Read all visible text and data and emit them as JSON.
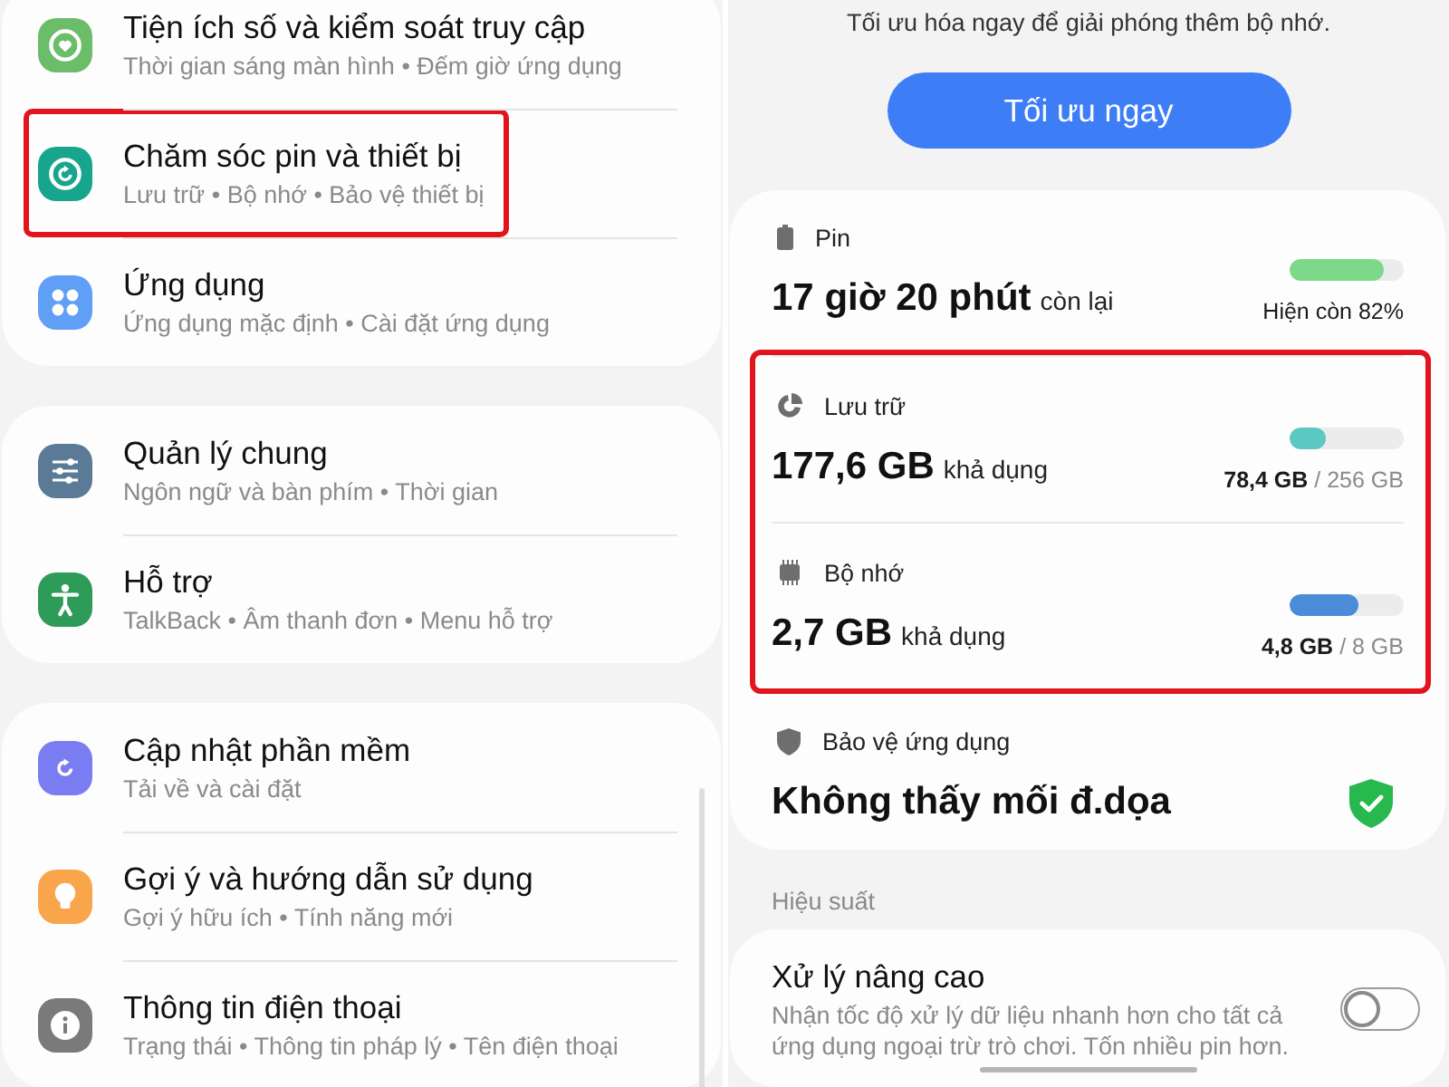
{
  "settings": {
    "groups": [
      {
        "items": [
          {
            "title": "Tiện ích số và kiểm soát truy cập",
            "subtitle": "Thời gian sáng màn hình • Đếm giờ ứng dụng",
            "color": "#6cbd6a",
            "highlighted": false
          },
          {
            "title": "Chăm sóc pin và thiết bị",
            "subtitle": "Lưu trữ • Bộ nhớ • Bảo vệ thiết bị",
            "color": "#17a68d",
            "highlighted": true
          },
          {
            "title": "Ứng dụng",
            "subtitle": "Ứng dụng mặc định • Cài đặt ứng dụng",
            "color": "#5f9ff5",
            "highlighted": false
          }
        ]
      },
      {
        "items": [
          {
            "title": "Quản lý chung",
            "subtitle": "Ngôn ngữ và bàn phím • Thời gian",
            "color": "#5a7a96",
            "highlighted": false
          },
          {
            "title": "Hỗ trợ",
            "subtitle": "TalkBack • Âm thanh đơn • Menu hỗ trợ",
            "color": "#2e9b58",
            "highlighted": false
          }
        ]
      },
      {
        "items": [
          {
            "title": "Cập nhật phần mềm",
            "subtitle": "Tải về và cài đặt",
            "color": "#7a7cf2",
            "highlighted": false
          },
          {
            "title": "Gợi ý và hướng dẫn sử dụng",
            "subtitle": "Gợi ý hữu ích • Tính năng mới",
            "color": "#f8a54b",
            "highlighted": false
          },
          {
            "title": "Thông tin điện thoại",
            "subtitle": "Trạng thái • Thông tin pháp lý • Tên điện thoại",
            "color": "#7a7a7a",
            "highlighted": false
          }
        ]
      }
    ]
  },
  "device_care": {
    "hint": "Tối ưu hóa ngay để giải phóng thêm bộ nhớ.",
    "optimize_button": "Tối ưu ngay",
    "meters": [
      {
        "kind": "battery",
        "label": "Pin",
        "value": "17 giờ 20 phút",
        "suffix": "còn lại",
        "level": 0.82,
        "color": "#7dd98a",
        "reading": "Hiện còn 82%",
        "highlighted": false
      },
      {
        "kind": "storage",
        "label": "Lưu trữ",
        "value": "177,6 GB",
        "suffix": "khả dụng",
        "level": 0.31,
        "color": "#5cc8c4",
        "reading": "**78,4 GB** / 256 GB",
        "highlighted": true
      },
      {
        "kind": "memory",
        "label": "Bộ nhớ",
        "value": "2,7 GB",
        "suffix": "khả dụng",
        "level": 0.6,
        "color": "#4b8bd8",
        "reading": "**4,8 GB** / 8 GB",
        "highlighted": true
      }
    ],
    "app_protection": {
      "label": "Bảo vệ ứng dụng",
      "status": "Không thấy mối đ.dọa"
    }
  },
  "performance": {
    "header": "Hiệu suất",
    "items": [
      {
        "title": "Xử lý nâng cao",
        "description": "Nhận tốc độ xử lý dữ liệu nhanh hơn cho tất cả ứng dụng ngoại trừ trò chơi. Tốn nhiều pin hơn.",
        "on": false
      }
    ]
  }
}
